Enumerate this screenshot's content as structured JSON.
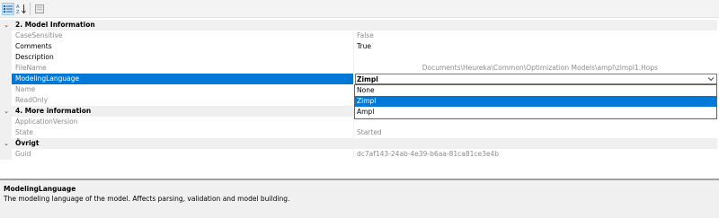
{
  "toolbar": {
    "buttons": [
      {
        "icon": "categorized-icon",
        "active": true
      },
      {
        "icon": "sort-alphabetical-icon",
        "active": false
      },
      {
        "icon": "property-pages-icon",
        "active": false
      }
    ]
  },
  "categories": [
    {
      "label": "2. Model Information",
      "expanded": true,
      "props": [
        {
          "name": "CaseSensitive",
          "value": "False",
          "readonly": true
        },
        {
          "name": "Comments",
          "value": "True",
          "readonly": false
        },
        {
          "name": "Description",
          "value": "",
          "readonly": false
        },
        {
          "name": "FileName",
          "value": "Documents\\Heureka\\Common\\Optimization Models\\ampl\\zimpl1.Hops",
          "readonly": true
        },
        {
          "name": "ModelingLanguage",
          "value": "Zimpl",
          "readonly": false,
          "selected": true
        },
        {
          "name": "Name",
          "value": "",
          "readonly": true
        },
        {
          "name": "ReadOnly",
          "value": "",
          "readonly": true
        }
      ]
    },
    {
      "label": "4. More information",
      "expanded": true,
      "props": [
        {
          "name": "ApplicationVersion",
          "value": "",
          "readonly": true
        },
        {
          "name": "State",
          "value": "Started",
          "readonly": true
        }
      ]
    },
    {
      "label": "Övrigt",
      "expanded": true,
      "props": [
        {
          "name": "Guid",
          "value": "dc7af143-24ab-4e39-b6aa-81ca81ce3e4b",
          "readonly": true
        }
      ]
    }
  ],
  "dropdown": {
    "options": [
      "None",
      "Zimpl",
      "Ampl"
    ],
    "highlighted": "Zimpl"
  },
  "help": {
    "title": "ModelingLanguage",
    "description": "The modeling language of the model. Affects parsing, validation and model building."
  },
  "colors": {
    "selection": "#0078d7",
    "category_bg": "#f0f0f0",
    "readonly_text": "#8c8c8c"
  }
}
